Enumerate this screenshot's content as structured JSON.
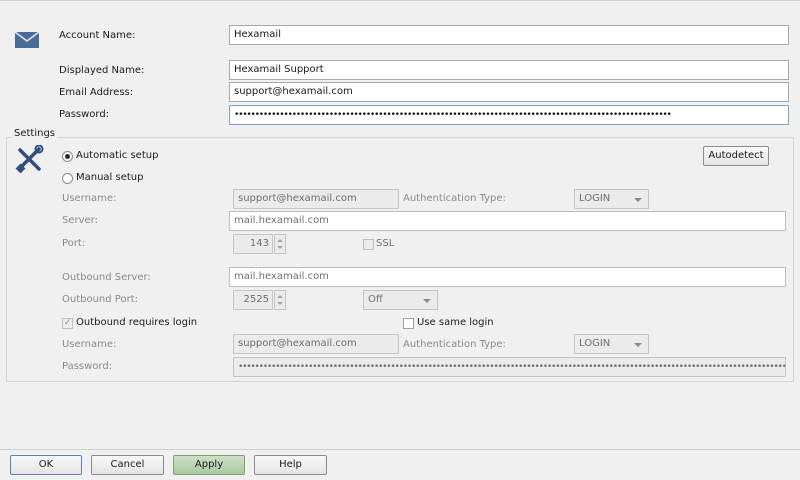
{
  "account": {
    "account_name_label": "Account Name:",
    "account_name_value": "Hexamail",
    "displayed_name_label": "Displayed Name:",
    "displayed_name_value": "Hexamail Support",
    "email_label": "Email Address:",
    "email_value": "support@hexamail.com",
    "password_label": "Password:",
    "password_value": "••••••••••••••••••••••••••••••••••••••••••••••••••••••••••••••••••••••••••••••••••••••••••••••••••••••••••"
  },
  "settings": {
    "group_title": "Settings",
    "automatic_setup": "Automatic setup",
    "manual_setup": "Manual setup",
    "autodetect_button": "Autodetect",
    "inbound": {
      "username_label": "Username:",
      "username_value": "support@hexamail.com",
      "auth_type_label": "Authentication Type:",
      "auth_type_value": "LOGIN",
      "server_label": "Server:",
      "server_value": "mail.hexamail.com",
      "port_label": "Port:",
      "port_value": "143",
      "ssl_label": "SSL"
    },
    "outbound": {
      "server_label": "Outbound Server:",
      "server_value": "mail.hexamail.com",
      "port_label": "Outbound Port:",
      "port_value": "2525",
      "security_value": "Off",
      "requires_login_label": "Outbound requires login",
      "use_same_login_label": "Use same login",
      "username_label": "Username:",
      "username_value": "support@hexamail.com",
      "auth_type_label": "Authentication Type:",
      "auth_type_value": "LOGIN",
      "password_label": "Password:",
      "password_value": "•••••••••••••••••••••••••••••••••••••••••••••••••••••••••••••••••••••••••••••••••••••••••••••••••••••••••••••••••••••••••••••••••••••••••"
    }
  },
  "footer": {
    "ok": "OK",
    "cancel": "Cancel",
    "apply": "Apply",
    "help": "Help"
  },
  "icons": {
    "account": "envelope-icon",
    "settings": "tools-icon"
  },
  "colors": {
    "icon_blue": "#3a5f8f",
    "apply_green": "#a9c8a0"
  }
}
